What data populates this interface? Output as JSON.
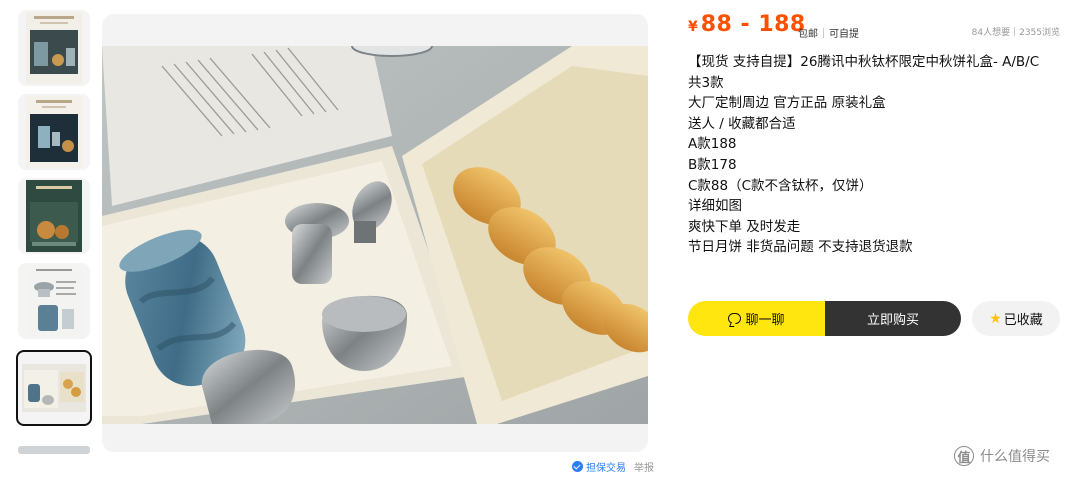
{
  "price": {
    "currency": "¥",
    "range": "88 - 188"
  },
  "shipping_tags": [
    "包邮",
    "可自提"
  ],
  "stats": {
    "wants": "84人想要",
    "views": "2355浏览"
  },
  "description_lines": [
    "【现货 支持自提】26腾讯中秋钛杯限定中秋饼礼盒- A/B/C",
    "共3款",
    "大厂定制周边 官方正品 原装礼盒",
    "送人 / 收藏都合适",
    "A款188",
    "B款178",
    "C款88（C款不含钛杯，仅饼）",
    "详细如图",
    "爽快下单 及时发走",
    "节日月饼 非货品问题 不支持退货退款"
  ],
  "buttons": {
    "chat": "聊一聊",
    "buy": "立即购买",
    "favorite": "已收藏"
  },
  "footer": {
    "guarantee": "担保交易",
    "report": "举报"
  },
  "watermark": {
    "logo": "值",
    "text": "什么值得买"
  },
  "icons": [
    "chat-bubble-icon",
    "star-icon",
    "shield-check-icon"
  ],
  "colors": {
    "price": "#ff5000",
    "chat_button": "#ffe60f",
    "buy_button": "#333333",
    "link_blue": "#2c7ef8"
  }
}
